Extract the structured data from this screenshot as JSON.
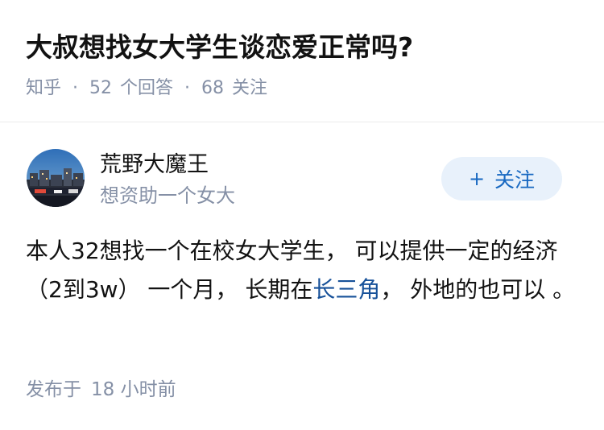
{
  "question": {
    "title": "大叔想找女大学生谈恋爱正常吗?",
    "source": "知乎",
    "separator": "·",
    "answer_count": "52",
    "answer_label": "个回答",
    "follower_count": "68",
    "follower_label": "关注"
  },
  "author": {
    "name": "荒野大魔王",
    "bio": "想资助一个女大",
    "avatar_icon": "avatar-night-city-photo"
  },
  "follow_button": {
    "plus": "+",
    "label": "关注"
  },
  "answer": {
    "text_before": "本人32想找一个在校女大学生， 可以提供一定的经济（2到3w） 一个月， 长期在",
    "link_text": "长三角",
    "text_after": "， 外地的也可以 。"
  },
  "footer": {
    "published_label": "发布于",
    "time_ago": "18 小时前"
  },
  "colors": {
    "link": "#175199",
    "meta": "#8590a6",
    "follow_bg": "#e8f1fb",
    "follow_text": "#1768c1"
  }
}
